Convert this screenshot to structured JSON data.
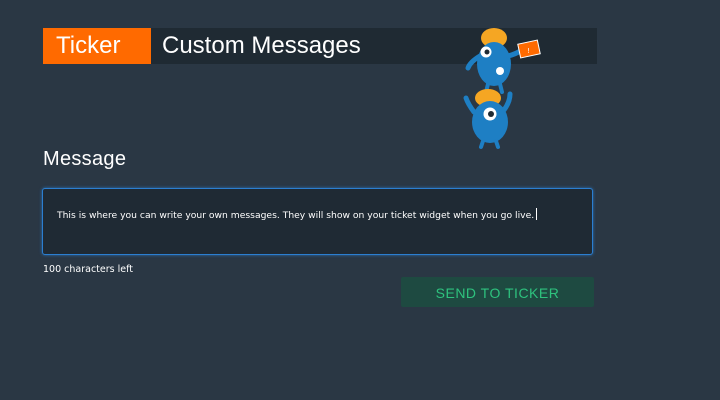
{
  "header": {
    "tag_label": "Ticker",
    "title": "Custom Messages"
  },
  "mascot": {
    "icon": "mascot-characters-illustration",
    "flag_mark": "!"
  },
  "message_section": {
    "label": "Message",
    "value": "This is where you can write your own messages. They will show on your ticket widget when you go live.",
    "characters_left": "100 characters left"
  },
  "send_button": {
    "label": "SEND TO TICKER"
  },
  "colors": {
    "background": "#2a3744",
    "header_bar": "#1f2a33",
    "accent_orange": "#ff6a00",
    "input_border": "#2b7ed0",
    "button_bg": "#1e4a41",
    "button_text": "#2ec27e",
    "mascot_blue": "#1e7fc4",
    "mascot_hair": "#f5a623"
  }
}
